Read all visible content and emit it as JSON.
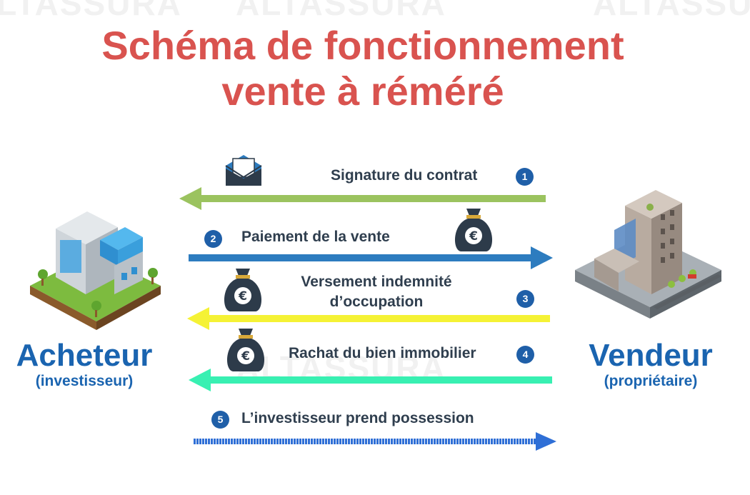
{
  "watermark": [
    "ALTASSURA",
    "ALTASSURA",
    "ALTASSURA",
    "ALTASSURA"
  ],
  "title": {
    "line1": "Schéma de fonctionnement",
    "line2": "vente à réméré"
  },
  "buyer": {
    "name": "Acheteur",
    "role": "(investisseur)"
  },
  "seller": {
    "name": "Vendeur",
    "role": "(propriétaire)"
  },
  "steps": [
    {
      "number": "1",
      "label": "Signature du contrat",
      "direction": "seller-to-buyer",
      "color": "#9bc35f",
      "icon": "envelope-icon"
    },
    {
      "number": "2",
      "label": "Paiement de la vente",
      "direction": "buyer-to-seller",
      "color": "#2d7cbf",
      "icon": "money-bag-icon"
    },
    {
      "number": "3",
      "label_line1": "Versement indemnité",
      "label_line2": "d’occupation",
      "direction": "seller-to-buyer",
      "color": "#f5f235",
      "icon": "money-bag-icon"
    },
    {
      "number": "4",
      "label": "Rachat du bien immobilier",
      "direction": "seller-to-buyer",
      "color": "#38f0b2",
      "icon": "money-bag-icon"
    },
    {
      "number": "5",
      "label": "L’investisseur prend possession",
      "direction": "buyer-to-seller",
      "color": "#2f6fd6",
      "icon": ""
    }
  ],
  "colors": {
    "title": "#d9534f",
    "party": "#1a64b0",
    "badge": "#1f5fa8",
    "label": "#2f3e4e"
  }
}
